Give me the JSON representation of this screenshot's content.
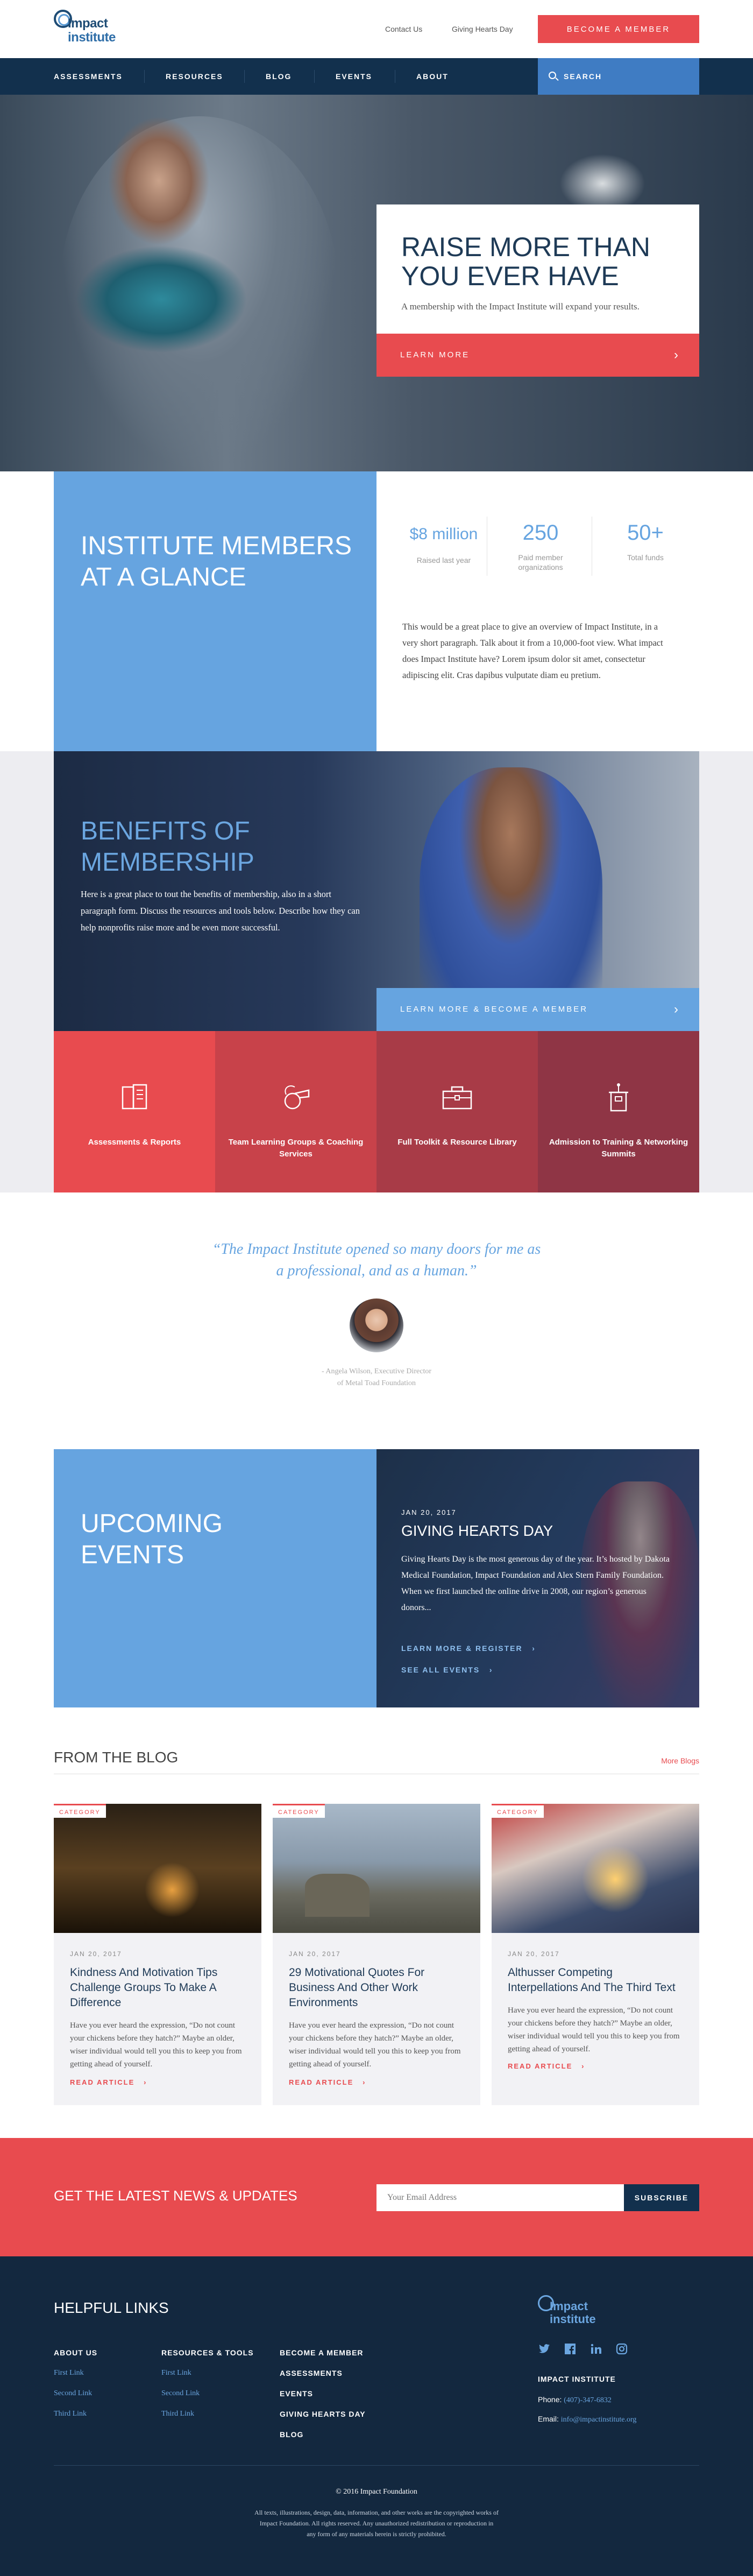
{
  "brand": {
    "logo_line1": "Impact",
    "logo_line2": "institute",
    "accent": "#e84b4f",
    "navy": "#12304d",
    "light_blue": "#66a4e0"
  },
  "topbar": {
    "links": [
      "Contact Us",
      "Giving Hearts Day"
    ],
    "cta": "BECOME A MEMBER"
  },
  "nav": {
    "items": [
      "ASSESSMENTS",
      "RESOURCES",
      "BLOG",
      "EVENTS",
      "ABOUT"
    ],
    "search_label": "SEARCH",
    "search_icon": "search-icon"
  },
  "hero": {
    "title_line1": "RAISE MORE THAN",
    "title_line2": "YOU EVER HAVE",
    "subtitle": "A membership with the Impact Institute will expand your results.",
    "button": "LEARN MORE"
  },
  "glance": {
    "title_line1": "INSTITUTE MEMBERS",
    "title_line2": "AT A GLANCE",
    "stats": [
      {
        "value": "$8 million",
        "label": "Raised last year"
      },
      {
        "value": "250",
        "label": "Paid member organizations"
      },
      {
        "value": "50+",
        "label": "Total funds"
      }
    ],
    "text": "This would be a great place to give an overview of Impact Institute, in a very short paragraph. Talk about it from a 10,000-foot view. What impact does Impact Institute have? Lorem ipsum dolor sit amet, consectetur adipiscing elit. Cras dapibus vulputate diam eu pretium."
  },
  "benefits": {
    "title_line1": "BENEFITS OF",
    "title_line2": "MEMBERSHIP",
    "text": "Here is a great place to tout the benefits of membership, also in a short paragraph form. Discuss the resources and tools below. Describe how they can help nonprofits raise more and be even more successful.",
    "button": "LEARN MORE & BECOME A MEMBER",
    "tiles": [
      {
        "label": "Assessments & Reports",
        "icon": "book-icon",
        "color": "#e84b4f"
      },
      {
        "label": "Team Learning Groups & Coaching Services",
        "icon": "whistle-icon",
        "color": "#c8424a"
      },
      {
        "label": "Full Toolkit & Resource Library",
        "icon": "toolbox-icon",
        "color": "#a83b47"
      },
      {
        "label": "Admission to Training & Networking Summits",
        "icon": "podium-icon",
        "color": "#8f3545"
      }
    ]
  },
  "testimonial": {
    "quote_line1": "“The Impact Institute opened so many doors for me as",
    "quote_line2": "a professional, and as a human.”",
    "attrib_line1": "- Angela Wilson, Executive Director",
    "attrib_line2": "of Metal Toad Foundation"
  },
  "events": {
    "title_line1": "UPCOMING",
    "title_line2": "EVENTS",
    "date": "JAN 20, 2017",
    "name": "GIVING HEARTS DAY",
    "text": "Giving Hearts Day is the most generous day of the year. It’s hosted by Dakota Medical Foundation, Impact Foundation and Alex Stern Family Foundation. When we first launched the online drive in 2008, our region’s generous donors...",
    "link1": "LEARN MORE & REGISTER",
    "link2": "SEE ALL EVENTS"
  },
  "blog": {
    "title": "FROM THE BLOG",
    "more": "More Blogs",
    "posts": [
      {
        "category": "CATEGORY",
        "date": "JAN 20, 2017",
        "title": "Kindness And Motivation Tips Challenge Groups To Make A Difference",
        "excerpt": "Have you ever heard the expression, “Do not count your chickens before they hatch?” Maybe an older, wiser individual would tell you this to keep you from getting ahead of yourself.",
        "link": "READ ARTICLE"
      },
      {
        "category": "CATEGORY",
        "date": "JAN 20, 2017",
        "title": "29 Motivational Quotes For Business And Other Work Environments",
        "excerpt": "Have you ever heard the expression, “Do not count your chickens before they hatch?” Maybe an older, wiser individual would tell you this to keep you from getting ahead of yourself.",
        "link": "READ ARTICLE"
      },
      {
        "category": "CATEGORY",
        "date": "JAN 20, 2017",
        "title": "Althusser Competing Interpellations And The Third Text",
        "excerpt": "Have you ever heard the expression, “Do not count your chickens before they hatch?” Maybe an older, wiser individual would tell you this to keep you from getting ahead of yourself.",
        "link": "READ ARTICLE"
      }
    ]
  },
  "newsletter": {
    "title": "GET THE LATEST NEWS & UPDATES",
    "placeholder": "Your Email Address",
    "button": "SUBSCRIBE"
  },
  "footer": {
    "title": "HELPFUL LINKS",
    "col1": {
      "head": "ABOUT US",
      "links": [
        "First Link",
        "Second Link",
        "Third Link"
      ]
    },
    "col2": {
      "head": "RESOURCES & TOOLS",
      "links": [
        "First Link",
        "Second Link",
        "Third Link"
      ]
    },
    "col3": [
      "BECOME A MEMBER",
      "ASSESSMENTS",
      "EVENTS",
      "GIVING HEARTS DAY",
      "BLOG"
    ],
    "social": [
      "twitter-icon",
      "facebook-icon",
      "linkedin-icon",
      "instagram-icon"
    ],
    "org": "IMPACT INSTITUTE",
    "phone_label": "Phone:",
    "phone": "(407)-347-6832",
    "email_label": "Email:",
    "email": "info@impactinstitute.org",
    "copyright": "© 2016 Impact Foundation",
    "legal_line1": "All texts, illustrations, design, data, information, and other works are the copyrighted works of",
    "legal_line2": "Impact Foundation. All rights reserved. Any unauthorized redistribution or reproduction in",
    "legal_line3": "any form of any materials herein is strictly prohibited."
  }
}
